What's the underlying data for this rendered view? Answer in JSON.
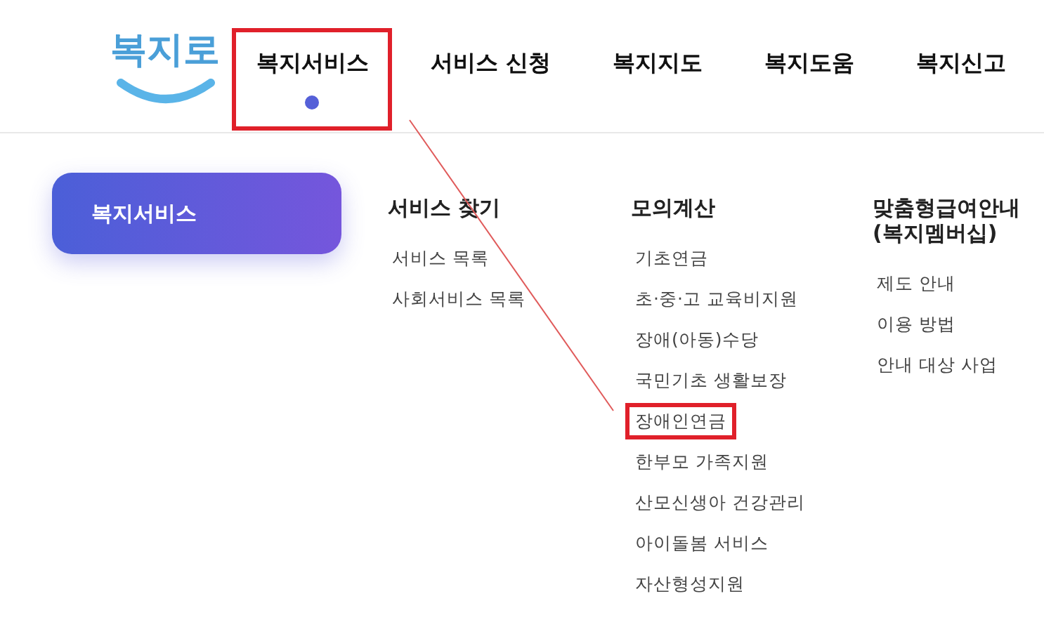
{
  "logo": {
    "text": "복지로"
  },
  "nav": [
    {
      "label": "복지서비스",
      "selected": true,
      "highlighted": true
    },
    {
      "label": "서비스 신청",
      "selected": false,
      "highlighted": false
    },
    {
      "label": "복지지도",
      "selected": false,
      "highlighted": false
    },
    {
      "label": "복지도움",
      "selected": false,
      "highlighted": false
    },
    {
      "label": "복지신고",
      "selected": false,
      "highlighted": false
    }
  ],
  "side_menu": [
    {
      "label": "복지서비스",
      "selected": true
    }
  ],
  "columns": [
    {
      "title": "서비스 찾기",
      "items": [
        {
          "label": "서비스 목록",
          "highlighted": false
        },
        {
          "label": "사회서비스 목록",
          "highlighted": false
        }
      ]
    },
    {
      "title": "모의계산",
      "items": [
        {
          "label": "기초연금",
          "highlighted": false
        },
        {
          "label": "초·중·고 교육비지원",
          "highlighted": false
        },
        {
          "label": "장애(아동)수당",
          "highlighted": false
        },
        {
          "label": "국민기초 생활보장",
          "highlighted": false
        },
        {
          "label": "장애인연금",
          "highlighted": true
        },
        {
          "label": "한부모 가족지원",
          "highlighted": false
        },
        {
          "label": "산모신생아 건강관리",
          "highlighted": false
        },
        {
          "label": "아이돌봄 서비스",
          "highlighted": false
        },
        {
          "label": "자산형성지원",
          "highlighted": false
        }
      ]
    },
    {
      "title": "맞춤형급여안내 (복지멤버십)",
      "items": [
        {
          "label": "제도 안내",
          "highlighted": false
        },
        {
          "label": "이용 방법",
          "highlighted": false
        },
        {
          "label": "안내 대상 사업",
          "highlighted": false
        }
      ]
    }
  ]
}
